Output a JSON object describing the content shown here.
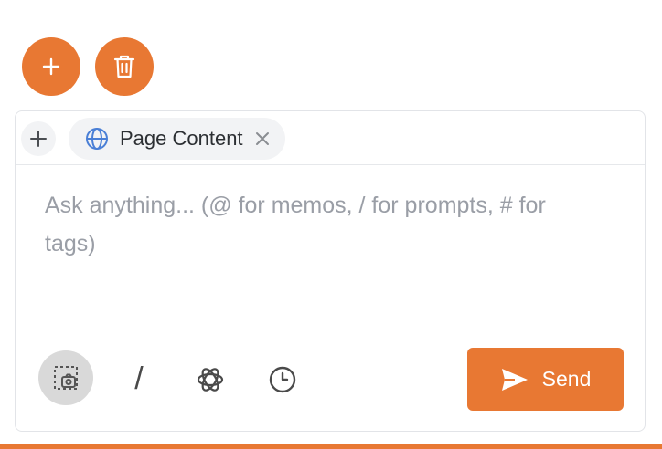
{
  "toolbar": {
    "add_icon": "plus-icon",
    "delete_icon": "trash-icon"
  },
  "context": {
    "add_icon": "plus-icon",
    "chip": {
      "icon": "globe-icon",
      "label": "Page Content",
      "close_icon": "close-icon"
    }
  },
  "input": {
    "placeholder": "Ask anything... (@ for memos, / for prompts, # for tags)"
  },
  "tools": {
    "screenshot_icon": "screenshot-icon",
    "slash_label": "/",
    "ai_icon": "openai-icon",
    "history_icon": "clock-icon"
  },
  "send": {
    "label": "Send",
    "icon": "send-icon"
  },
  "colors": {
    "accent": "#e87833",
    "chip_background": "#f2f3f5",
    "placeholder_text": "#9a9ea6",
    "globe": "#4a7fd6"
  }
}
